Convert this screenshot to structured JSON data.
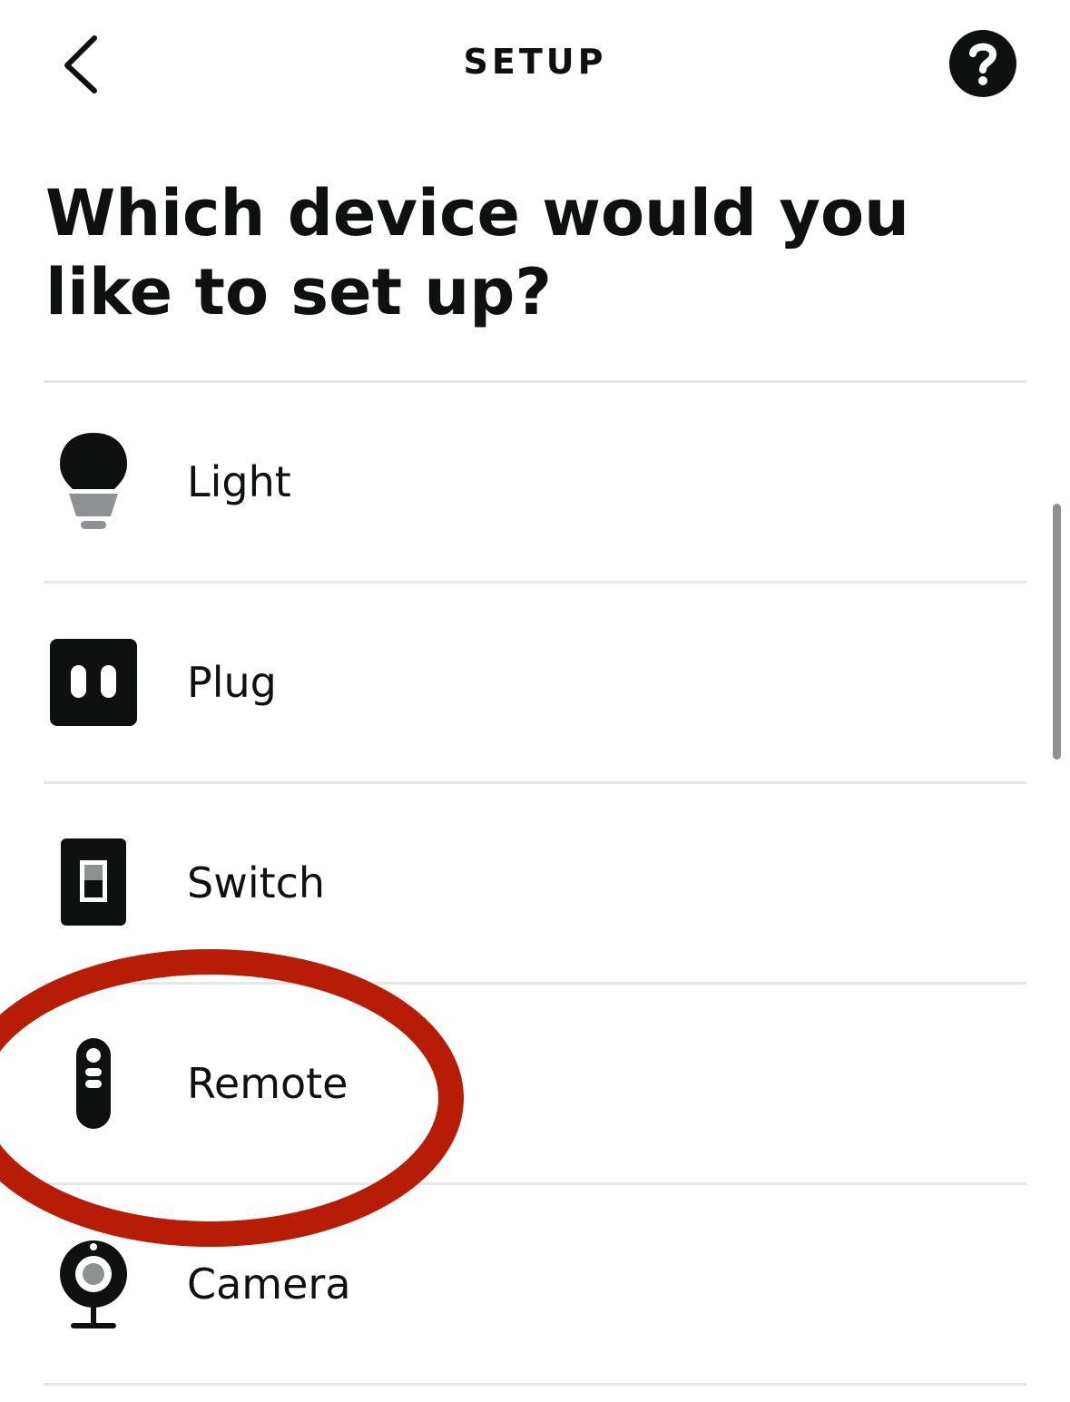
{
  "header": {
    "title": "SETUP",
    "back_icon": "chevron-left-icon",
    "help_icon": "question-mark-icon"
  },
  "heading": "Which device would you like to set up?",
  "devices": [
    {
      "label": "Light",
      "icon": "lightbulb-icon"
    },
    {
      "label": "Plug",
      "icon": "plug-icon"
    },
    {
      "label": "Switch",
      "icon": "switch-icon"
    },
    {
      "label": "Remote",
      "icon": "remote-icon"
    },
    {
      "label": "Camera",
      "icon": "camera-icon"
    }
  ],
  "colors": {
    "text": "#0f1111",
    "divider": "#e6e8e8",
    "icon_gray": "#8d9191",
    "annotation_red": "#b71c06"
  }
}
